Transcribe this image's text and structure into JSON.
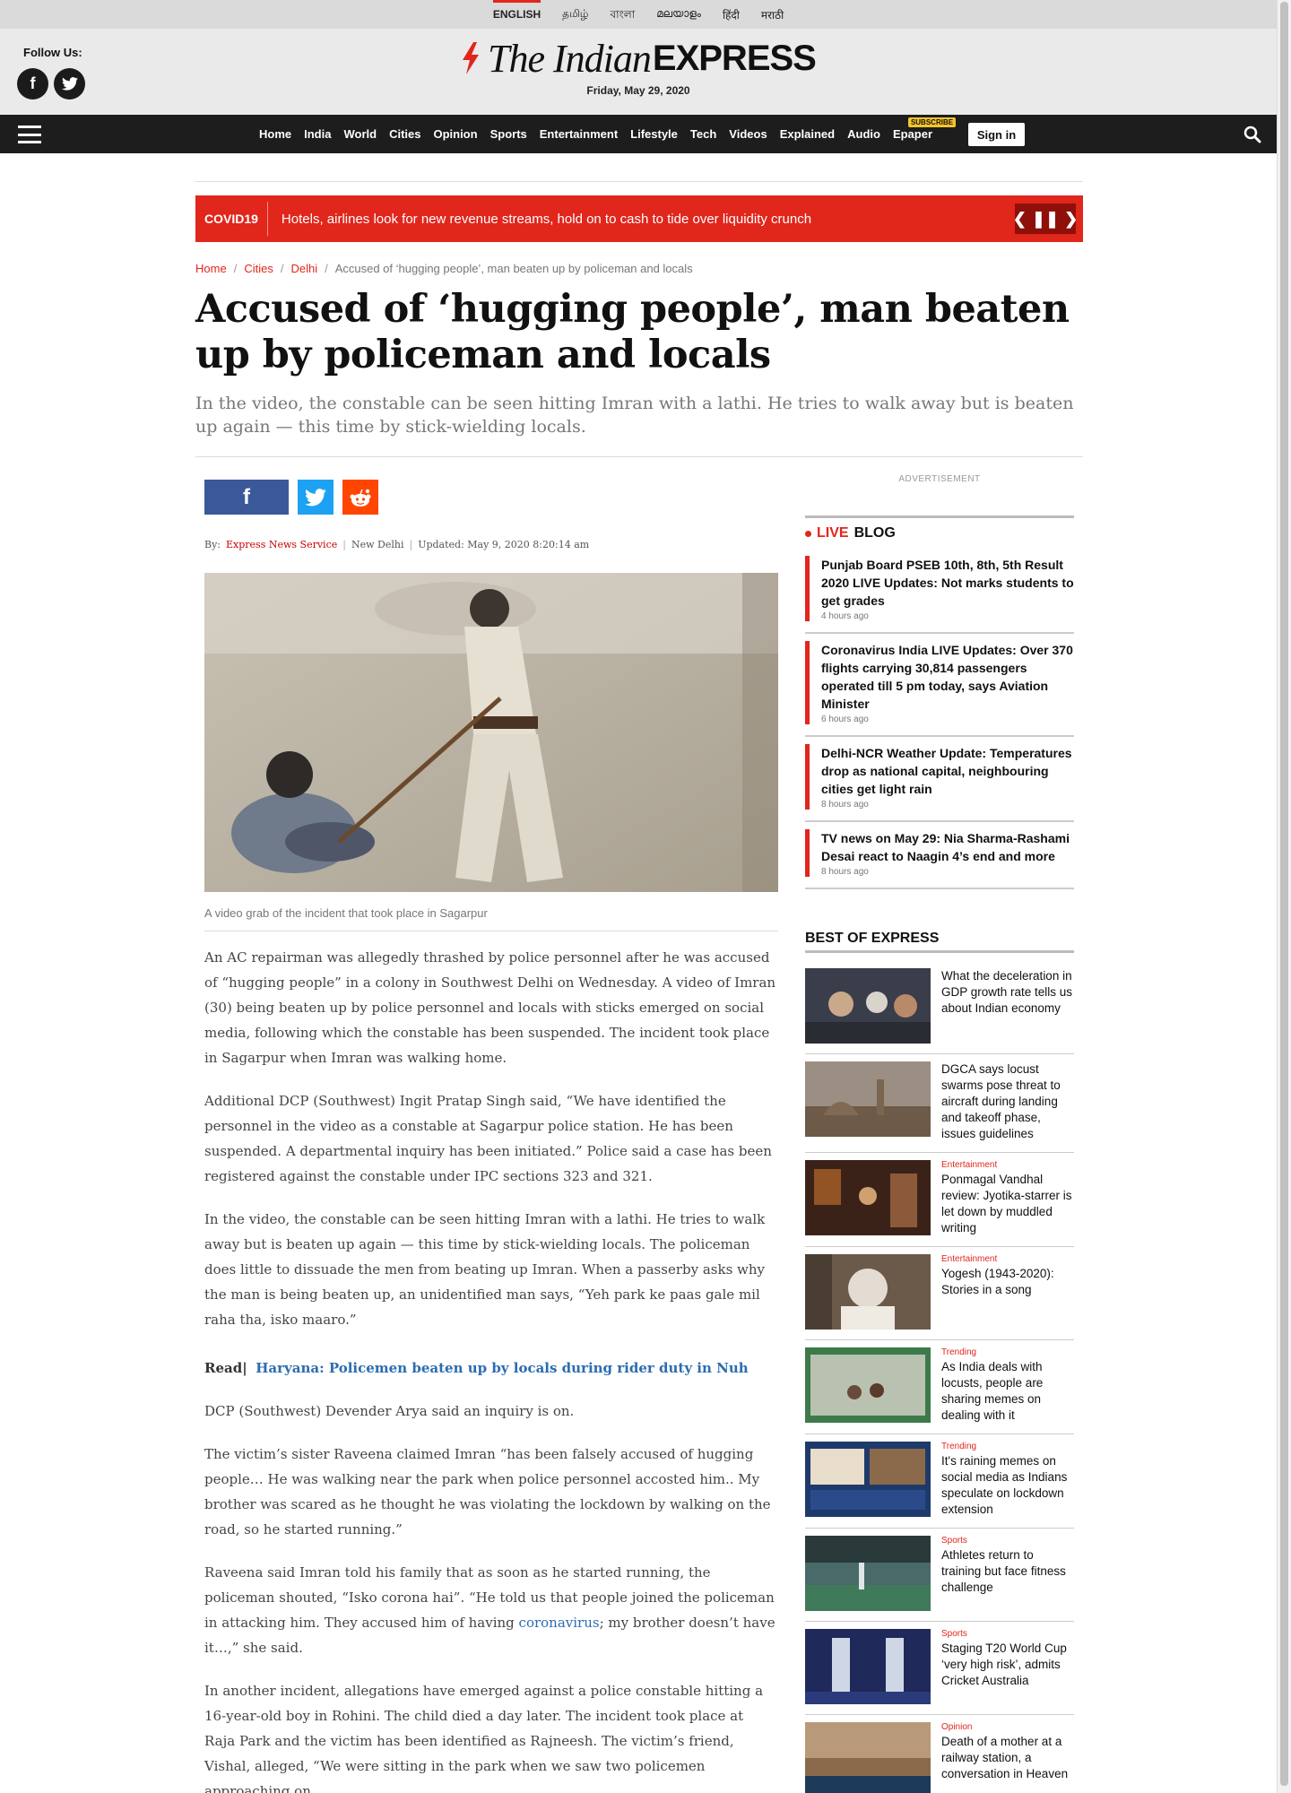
{
  "langs": [
    "ENGLISH",
    "தமிழ்",
    "বাংলা",
    "മലയാളം",
    "हिंदी",
    "मराठी"
  ],
  "header": {
    "follow": "Follow Us:",
    "logo_italic": "The Indian",
    "logo_bold": "EXPRESS",
    "date": "Friday, May 29, 2020"
  },
  "nav": {
    "items": [
      "Home",
      "India",
      "World",
      "Cities",
      "Opinion",
      "Sports",
      "Entertainment",
      "Lifestyle",
      "Tech",
      "Videos",
      "Explained",
      "Audio",
      "Epaper"
    ],
    "subscribe_badge": "SUBSCRIBE",
    "signin": "Sign in"
  },
  "ticker": {
    "tag": "COVID19",
    "headline": "Hotels, airlines look for new revenue streams, hold on to cash to tide over liquidity crunch"
  },
  "breadcrumb": [
    "Home",
    "Cities",
    "Delhi",
    "Accused of ‘hugging people’, man beaten up by policeman and locals"
  ],
  "article": {
    "title": "Accused of ‘hugging people’, man beaten up by policeman and locals",
    "dek": "In the video, the constable can be seen hitting Imran with a lathi. He tries to walk away but is beaten up again — this time by stick-wielding locals.",
    "by_label": "By:",
    "author": "Express News Service",
    "location": "New Delhi",
    "updated": "Updated: May 9, 2020 8:20:14 am",
    "caption": "A video grab of the incident that took place in Sagarpur",
    "p1": "An AC repairman was allegedly thrashed by police personnel after he was accused of “hugging people” in a colony in Southwest Delhi on Wednesday. A video of Imran (30) being beaten up by police personnel and locals with sticks emerged on social media, following which the constable has been suspended. The incident took place in Sagarpur when Imran was walking home.",
    "p2": "Additional DCP (Southwest) Ingit Pratap Singh said, “We have identified the personnel in the video as a constable at Sagarpur police station. He has been suspended. A departmental inquiry has been initiated.” Police said a case has been registered against the constable under IPC sections 323 and 321.",
    "p3": "In the video, the constable can be seen hitting Imran with a lathi. He tries to walk away but is beaten up again — this time by stick-wielding locals. The policeman does little to dissuade the men from beating up Imran. When a passerby asks why the man is being beaten up, an unidentified man says, “Yeh park ke paas gale mil raha tha, isko maaro.”",
    "read_label": "Read",
    "read_link": "Haryana: Policemen beaten up by locals during rider duty in Nuh",
    "p4": "DCP (Southwest) Devender Arya said an inquiry is on.",
    "p5": "The victim’s sister Raveena claimed Imran “has been falsely accused of hugging people… He was walking near the park when police personnel accosted him.. My brother was scared as he thought he was violating the lockdown by walking on the road, so he started running.”",
    "p6_a": "Raveena said Imran told his family that as soon as he started running, the policeman shouted, “Isko corona hai”. “He told us that people joined the policeman in attacking him. They accused him of having ",
    "p6_link": "coronavirus",
    "p6_b": "; my brother doesn’t have it…,” she said.",
    "p7": "In another incident, allegations have emerged against a police constable hitting a 16-year-old boy in Rohini. The child died a day later. The incident took place at Raja Park and the victim has been identified as Rajneesh. The victim’s friend, Vishal, alleged, “We were sitting in the park when we saw two policemen approaching on"
  },
  "sidebar": {
    "advert": "ADVERTISEMENT",
    "live_label": "LIVE",
    "blog_label": "BLOG",
    "live": [
      {
        "title": "Punjab Board PSEB 10th, 8th, 5th Result 2020 LIVE Updates: Not marks students to get grades",
        "time": "4 hours ago"
      },
      {
        "title": "Coronavirus India LIVE Updates: Over 370 flights carrying 30,814 passengers operated till 5 pm today, says Aviation Minister",
        "time": "6 hours ago"
      },
      {
        "title": "Delhi-NCR Weather Update: Temperatures drop as national capital, neighbouring cities get light rain",
        "time": "8 hours ago"
      },
      {
        "title": "TV news on May 29: Nia Sharma-Rashami Desai react to Naagin 4’s end and more",
        "time": "8 hours ago"
      }
    ],
    "best_head": "BEST OF EXPRESS",
    "best": [
      {
        "cat": "",
        "title": "What the deceleration in GDP growth rate tells us about Indian economy"
      },
      {
        "cat": "",
        "title": "DGCA says locust swarms pose threat to aircraft during landing and takeoff phase, issues guidelines"
      },
      {
        "cat": "Entertainment",
        "title": "Ponmagal Vandhal review: Jyotika-starrer is let down by muddled writing"
      },
      {
        "cat": "Entertainment",
        "title": "Yogesh (1943-2020): Stories in a song"
      },
      {
        "cat": "Trending",
        "title": "As India deals with locusts, people are sharing memes on dealing with it"
      },
      {
        "cat": "Trending",
        "title": "It's raining memes on social media as Indians speculate on lockdown extension"
      },
      {
        "cat": "Sports",
        "title": "Athletes return to training but face fitness challenge"
      },
      {
        "cat": "Sports",
        "title": "Staging T20 World Cup ‘very high risk’, admits Cricket Australia"
      },
      {
        "cat": "Opinion",
        "title": "Death of a mother at a railway station, a conversation in Heaven"
      }
    ]
  }
}
